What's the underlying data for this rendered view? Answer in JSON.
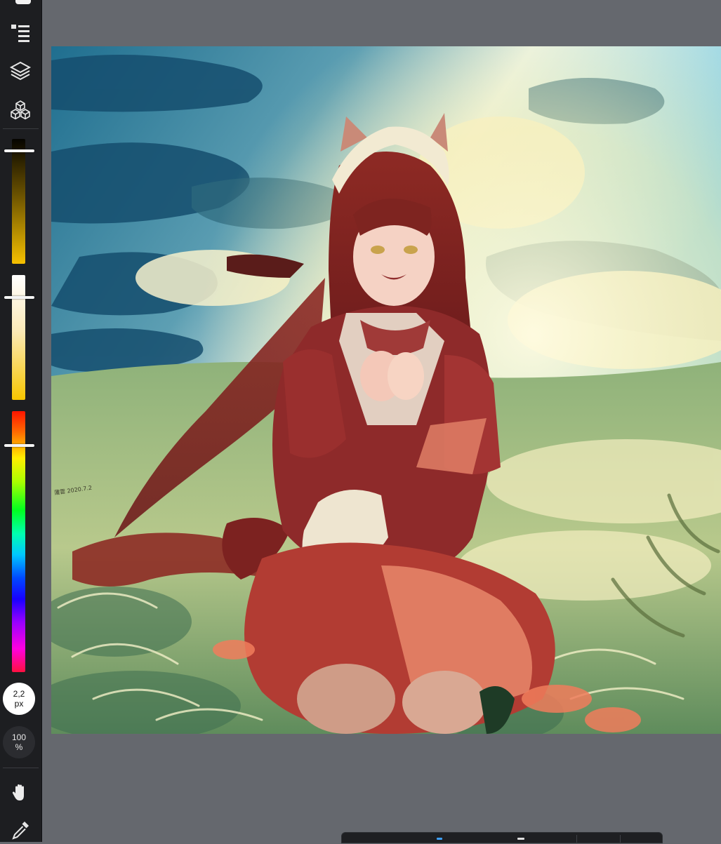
{
  "toolbar": {
    "brush_size": {
      "value": "2,2",
      "unit": "px"
    },
    "opacity": {
      "value": "100",
      "unit": "%"
    },
    "sliders": {
      "brightness_level": 0.09,
      "saturation_level": 0.18,
      "hue_level": 0.13
    },
    "icons": [
      "menu-icon",
      "layers-icon",
      "cubes-icon",
      "hand-icon",
      "eyedropper-icon"
    ]
  },
  "canvas": {
    "signature_text": "蓮雲 2020.7.2"
  },
  "colors": {
    "toolbar_bg": "#1d1e21",
    "workspace_bg": "#65686e",
    "accent_blue": "#3da0ff"
  }
}
